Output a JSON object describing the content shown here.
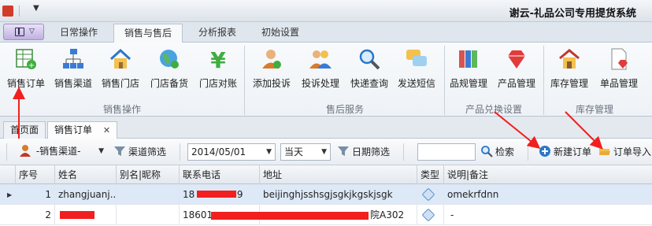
{
  "window": {
    "title": "谢云-礼品公司专用提货系统"
  },
  "tabs": [
    "日常操作",
    "销售与售后",
    "分析报表",
    "初始设置"
  ],
  "active_tab_index": 1,
  "ribbon": {
    "buttons": [
      "销售订单",
      "销售渠道",
      "销售门店",
      "门店备货",
      "门店对账",
      "添加投诉",
      "投诉处理",
      "快递查询",
      "发送短信",
      "品规管理",
      "产品管理",
      "库存管理",
      "单品管理"
    ],
    "groups": [
      "销售操作",
      "售后服务",
      "产品兑换设置",
      "库存管理"
    ]
  },
  "doc_tabs": {
    "home": "首页面",
    "order": "销售订单",
    "close": "✕"
  },
  "toolbar": {
    "channel_combo": "-销售渠道-",
    "channel_filter": "渠道筛选",
    "date_value": "2014/05/01",
    "period_value": "当天",
    "date_filter": "日期筛选",
    "search_value": "",
    "search_label": "检索",
    "new_order": "新建订单",
    "import_order": "订单导入"
  },
  "grid": {
    "columns": [
      "序号",
      "姓名",
      "别名|昵称",
      "联系电话",
      "地址",
      "类型",
      "说明|备注"
    ],
    "rows": [
      {
        "no": "1",
        "name": "zhangjuanj...",
        "alias": "",
        "phone": "18",
        "phone_tail": "49",
        "address": "beijinghjsshsgjsgkjkgskjsgk",
        "note": "omekrfdnn"
      },
      {
        "no": "2",
        "name": "",
        "alias": "",
        "phone": "18601",
        "phone_tail": "",
        "address": "院A302",
        "note": "-"
      }
    ]
  },
  "colors": {
    "accent_red": "#f21f1f",
    "selected_row": "#dde9f7"
  }
}
